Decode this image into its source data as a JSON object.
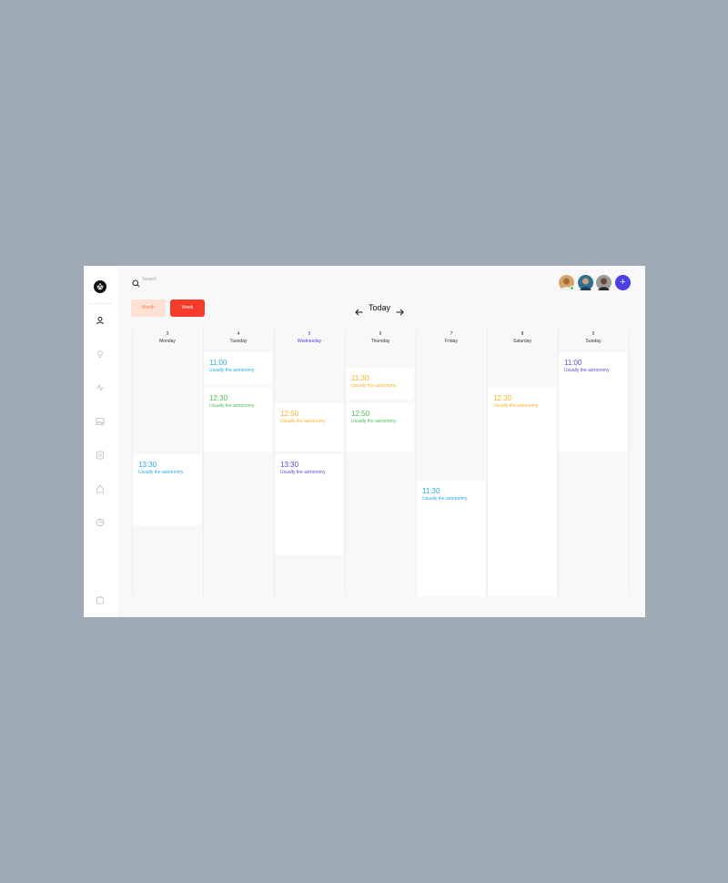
{
  "search": {
    "placeholder": "Search"
  },
  "view_switch": {
    "month_label": "Month",
    "week_label": "Week"
  },
  "nav": {
    "today_label": "Today"
  },
  "colors": {
    "accent": "#4c3ee8",
    "primary_button": "#f53b2a",
    "blue": "#28a9e0",
    "green": "#4cbc5a",
    "yellow": "#f5b52a",
    "purple": "#5a4bd6"
  },
  "days": [
    {
      "num": "3",
      "name": "Monday"
    },
    {
      "num": "4",
      "name": "Tuesday"
    },
    {
      "num": "5",
      "name": "Wednesday"
    },
    {
      "num": "6",
      "name": "Thursday"
    },
    {
      "num": "7",
      "name": "Friday"
    },
    {
      "num": "8",
      "name": "Saturday"
    },
    {
      "num": "9",
      "name": "Sunday"
    }
  ],
  "events": [
    {
      "time": "13:30",
      "desc": "Usually the astronomy"
    },
    {
      "time": "11:00",
      "desc": "Usually the astronomy"
    },
    {
      "time": "12:30",
      "desc": "Usually the astronomy"
    },
    {
      "time": "12:50",
      "desc": "Usually the astronomy"
    },
    {
      "time": "13:30",
      "desc": "Usually the astronomy"
    },
    {
      "time": "11:30",
      "desc": "Usually the astronomy"
    },
    {
      "time": "12:50",
      "desc": "Usually the astronomy"
    },
    {
      "time": "11:30",
      "desc": "Usually the astronomy"
    },
    {
      "time": "12:30",
      "desc": "Usually the astronomy"
    },
    {
      "time": "11:00",
      "desc": "Usually the astronomy"
    }
  ]
}
